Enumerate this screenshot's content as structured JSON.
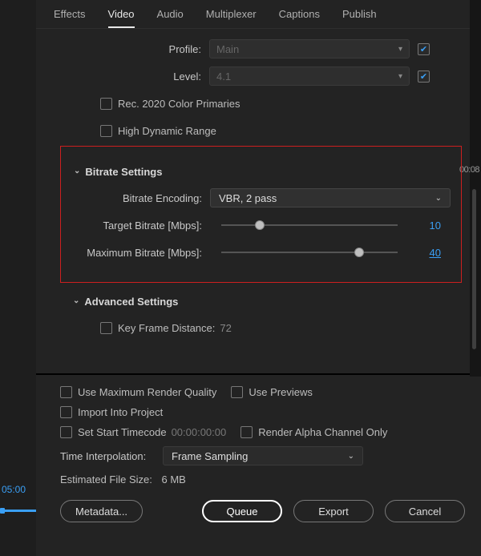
{
  "left": {
    "timecode": "05:00"
  },
  "right": {
    "timecode": "00:08"
  },
  "tabs": {
    "effects": "Effects",
    "video": "Video",
    "audio": "Audio",
    "multiplexer": "Multiplexer",
    "captions": "Captions",
    "publish": "Publish"
  },
  "profile": {
    "label": "Profile:",
    "value": "Main"
  },
  "level": {
    "label": "Level:",
    "value": "4.1"
  },
  "rec2020": {
    "label": "Rec. 2020 Color Primaries"
  },
  "hdr": {
    "label": "High Dynamic Range"
  },
  "bitrate": {
    "header": "Bitrate Settings",
    "encoding_label": "Bitrate Encoding:",
    "encoding_value": "VBR, 2 pass",
    "target_label": "Target Bitrate [Mbps]:",
    "target_value": "10",
    "max_label": "Maximum Bitrate [Mbps]:",
    "max_value": "40"
  },
  "advanced": {
    "header": "Advanced Settings",
    "kfd_label": "Key Frame Distance:",
    "kfd_value": "72"
  },
  "bottom": {
    "umrq": "Use Maximum Render Quality",
    "previews": "Use Previews",
    "import": "Import Into Project",
    "set_start": "Set Start Timecode",
    "start_tc": "00:00:00:00",
    "alpha": "Render Alpha Channel Only",
    "tint_label": "Time Interpolation:",
    "tint_value": "Frame Sampling",
    "est_label": "Estimated File Size:",
    "est_value": "6 MB"
  },
  "buttons": {
    "metadata": "Metadata...",
    "queue": "Queue",
    "export": "Export",
    "cancel": "Cancel"
  }
}
